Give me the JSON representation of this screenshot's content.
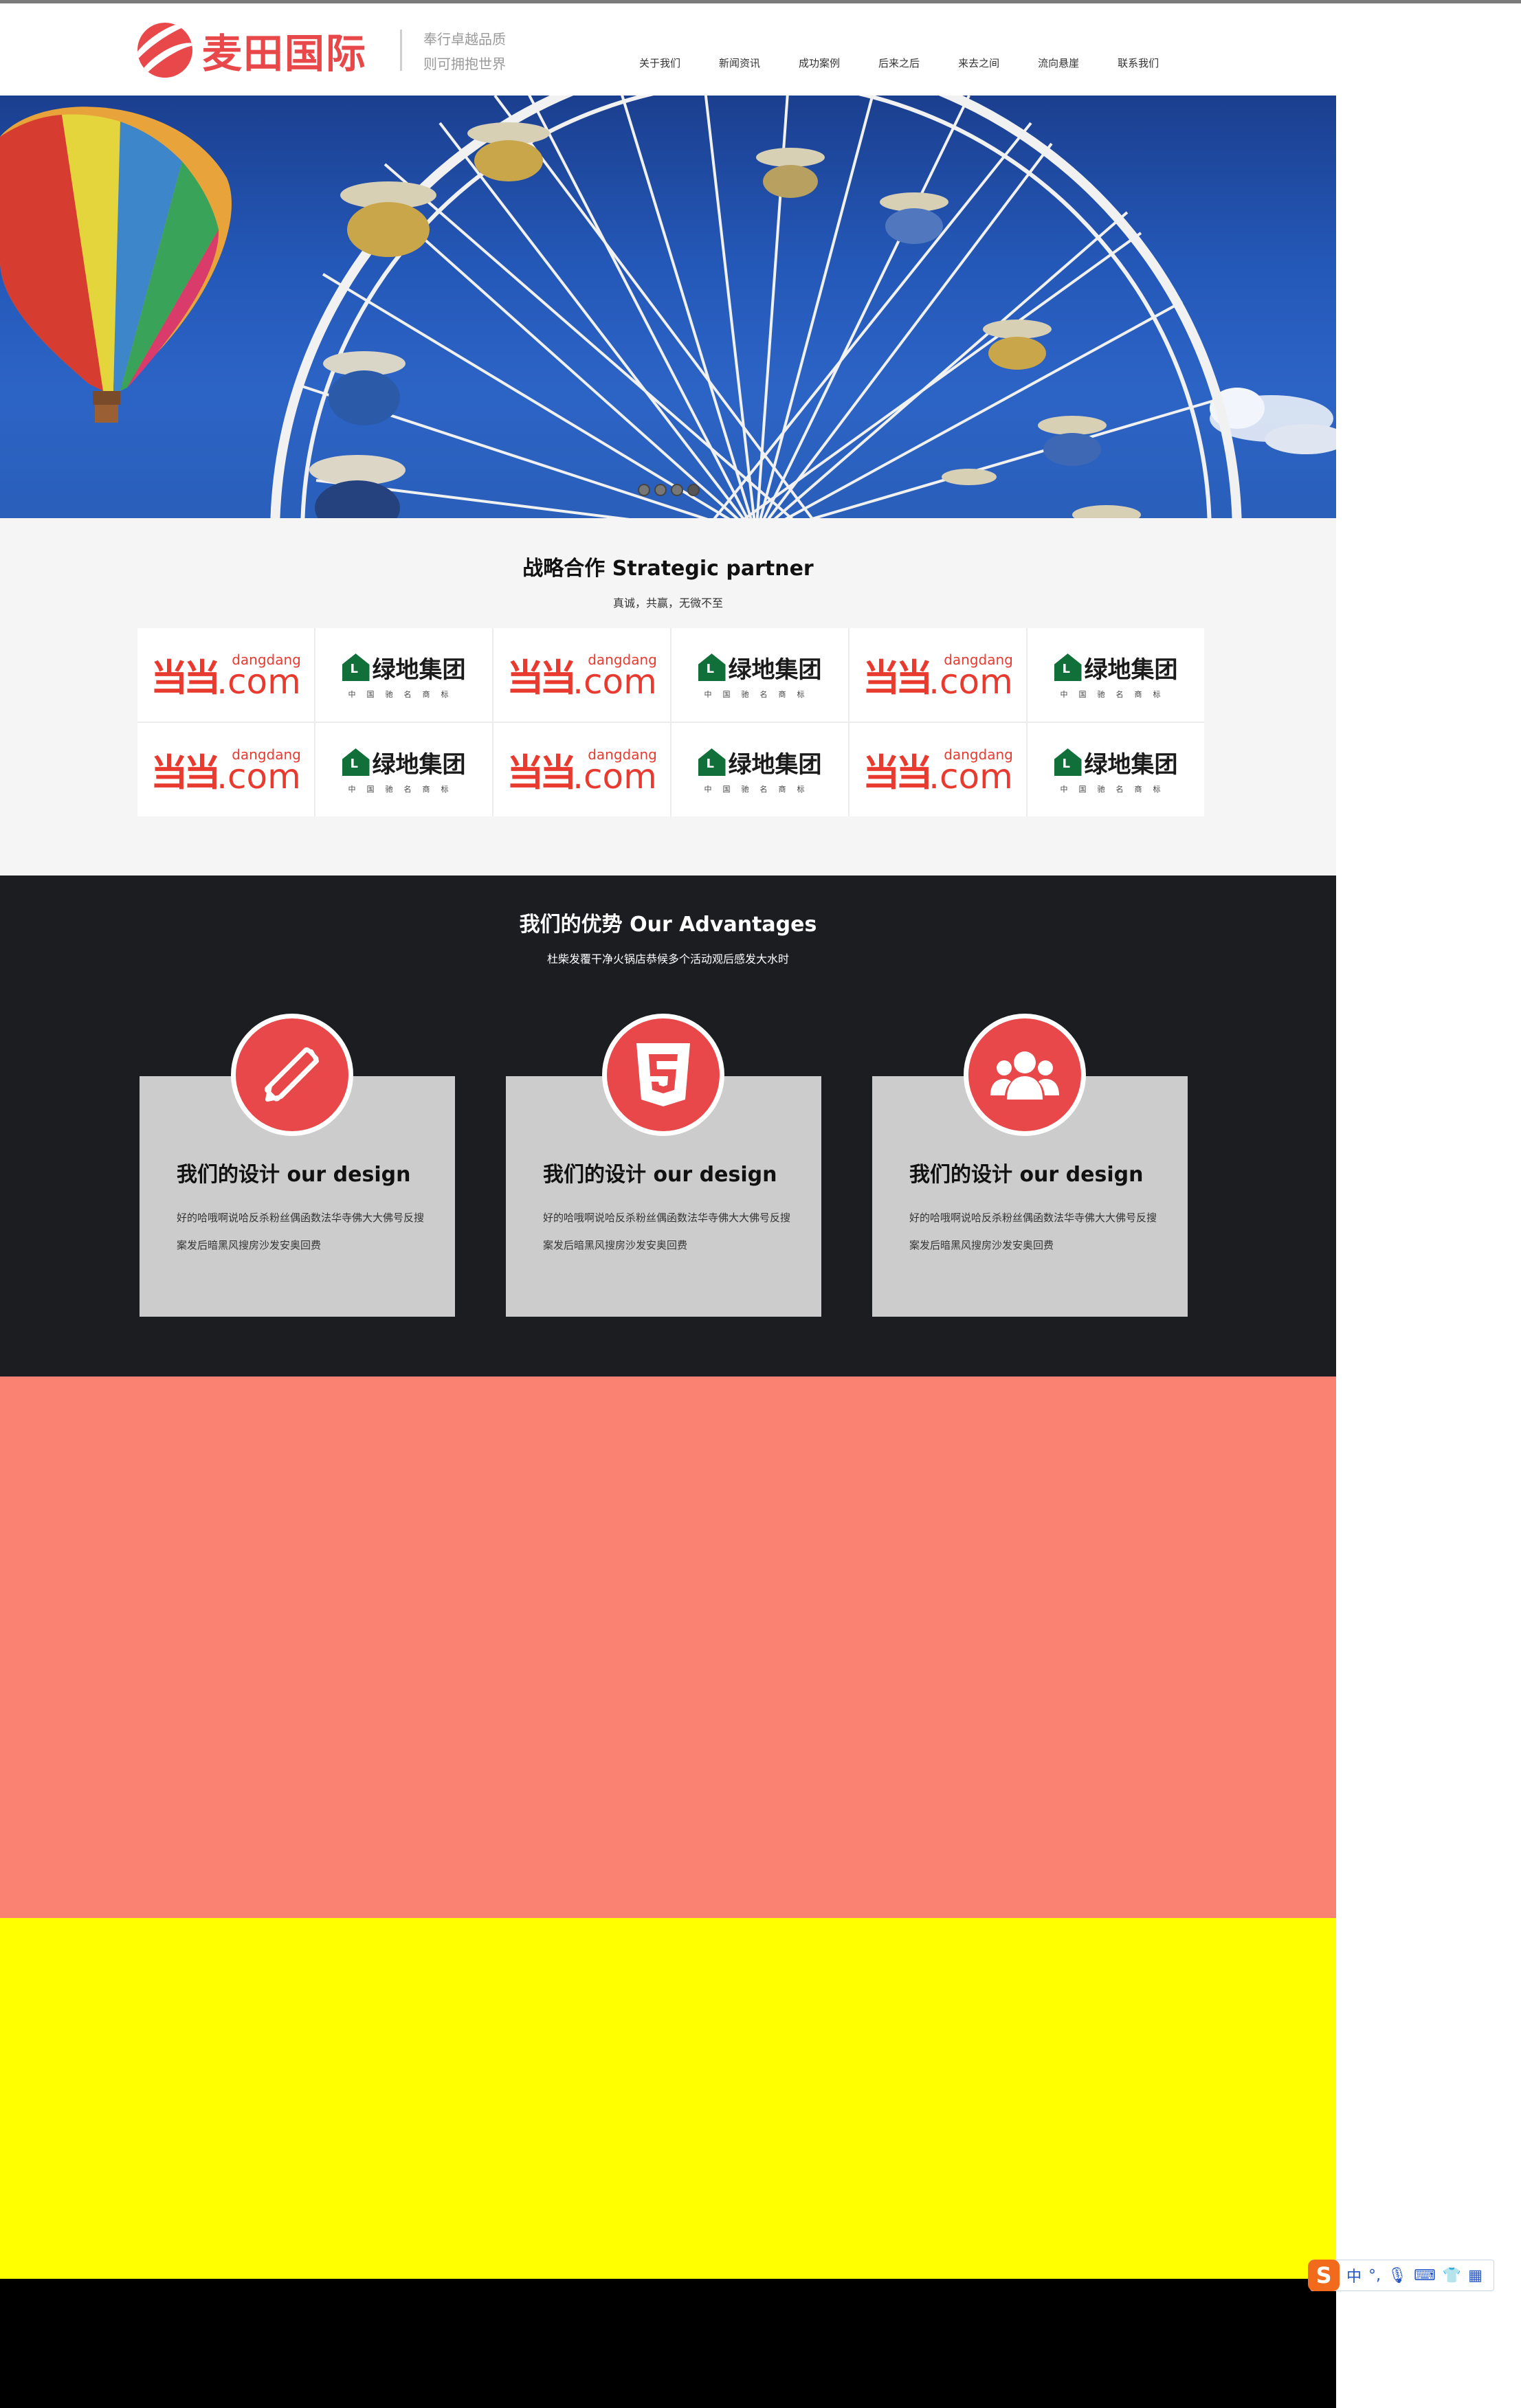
{
  "header": {
    "logo_text": "麦田国际",
    "slogan_line1": "奉行卓越品质",
    "slogan_line2": "则可拥抱世界",
    "nav": [
      "关于我们",
      "新闻资讯",
      "成功案例",
      "后来之后",
      "来去之间",
      "流向悬崖",
      "联系我们"
    ]
  },
  "hero": {
    "dots": 4,
    "active_dot": 3
  },
  "partners": {
    "title": "战略合作 Strategic partner",
    "subtitle": "真诚，共赢，无微不至",
    "logos": [
      {
        "type": "dangdang",
        "mark": "当",
        "small": "dangdang",
        "com": ".com"
      },
      {
        "type": "lvdi",
        "house": "L",
        "name": "绿地集团",
        "tag": "中国驰名商标"
      },
      {
        "type": "dangdang",
        "mark": "当",
        "small": "dangdang",
        "com": ".com"
      },
      {
        "type": "lvdi",
        "house": "L",
        "name": "绿地集团",
        "tag": "中国驰名商标"
      },
      {
        "type": "dangdang",
        "mark": "当",
        "small": "dangdang",
        "com": ".com"
      },
      {
        "type": "lvdi",
        "house": "L",
        "name": "绿地集团",
        "tag": "中国驰名商标"
      },
      {
        "type": "dangdang",
        "mark": "当",
        "small": "dangdang",
        "com": ".com"
      },
      {
        "type": "lvdi",
        "house": "L",
        "name": "绿地集团",
        "tag": "中国驰名商标"
      },
      {
        "type": "dangdang",
        "mark": "当",
        "small": "dangdang",
        "com": ".com"
      },
      {
        "type": "lvdi",
        "house": "L",
        "name": "绿地集团",
        "tag": "中国驰名商标"
      },
      {
        "type": "dangdang",
        "mark": "当",
        "small": "dangdang",
        "com": ".com"
      },
      {
        "type": "lvdi",
        "house": "L",
        "name": "绿地集团",
        "tag": "中国驰名商标"
      }
    ]
  },
  "advantages": {
    "title": "我们的优势 Our Advantages",
    "subtitle": "杜柴发覆干净火锅店恭候多个活动观后感发大水时",
    "cards": [
      {
        "icon": "pencil-ruler-icon",
        "title": "我们的设计 our design",
        "text": "好的哈哦啊说哈反杀粉丝偶函数法华寺佛大大佛号反搜案发后暗黑风搜房沙发安奥回费"
      },
      {
        "icon": "html5-icon",
        "title": "我们的设计 our design",
        "text": "好的哈哦啊说哈反杀粉丝偶函数法华寺佛大大佛号反搜案发后暗黑风搜房沙发安奥回费"
      },
      {
        "icon": "users-icon",
        "title": "我们的设计 our design",
        "text": "好的哈哦啊说哈反杀粉丝偶函数法华寺佛大大佛号反搜案发后暗黑风搜房沙发安奥回费"
      }
    ]
  },
  "colors": {
    "brand": "#e8484a",
    "dark_section": "#1c1d21",
    "salmon_section": "#f98272",
    "yellow_section": "#ffff00",
    "black_section": "#000000"
  },
  "ime": {
    "logo": "S",
    "lang": "中",
    "icons": [
      "punctuation-icon",
      "microphone-icon",
      "keyboard-icon",
      "skin-icon",
      "grid-icon"
    ]
  }
}
